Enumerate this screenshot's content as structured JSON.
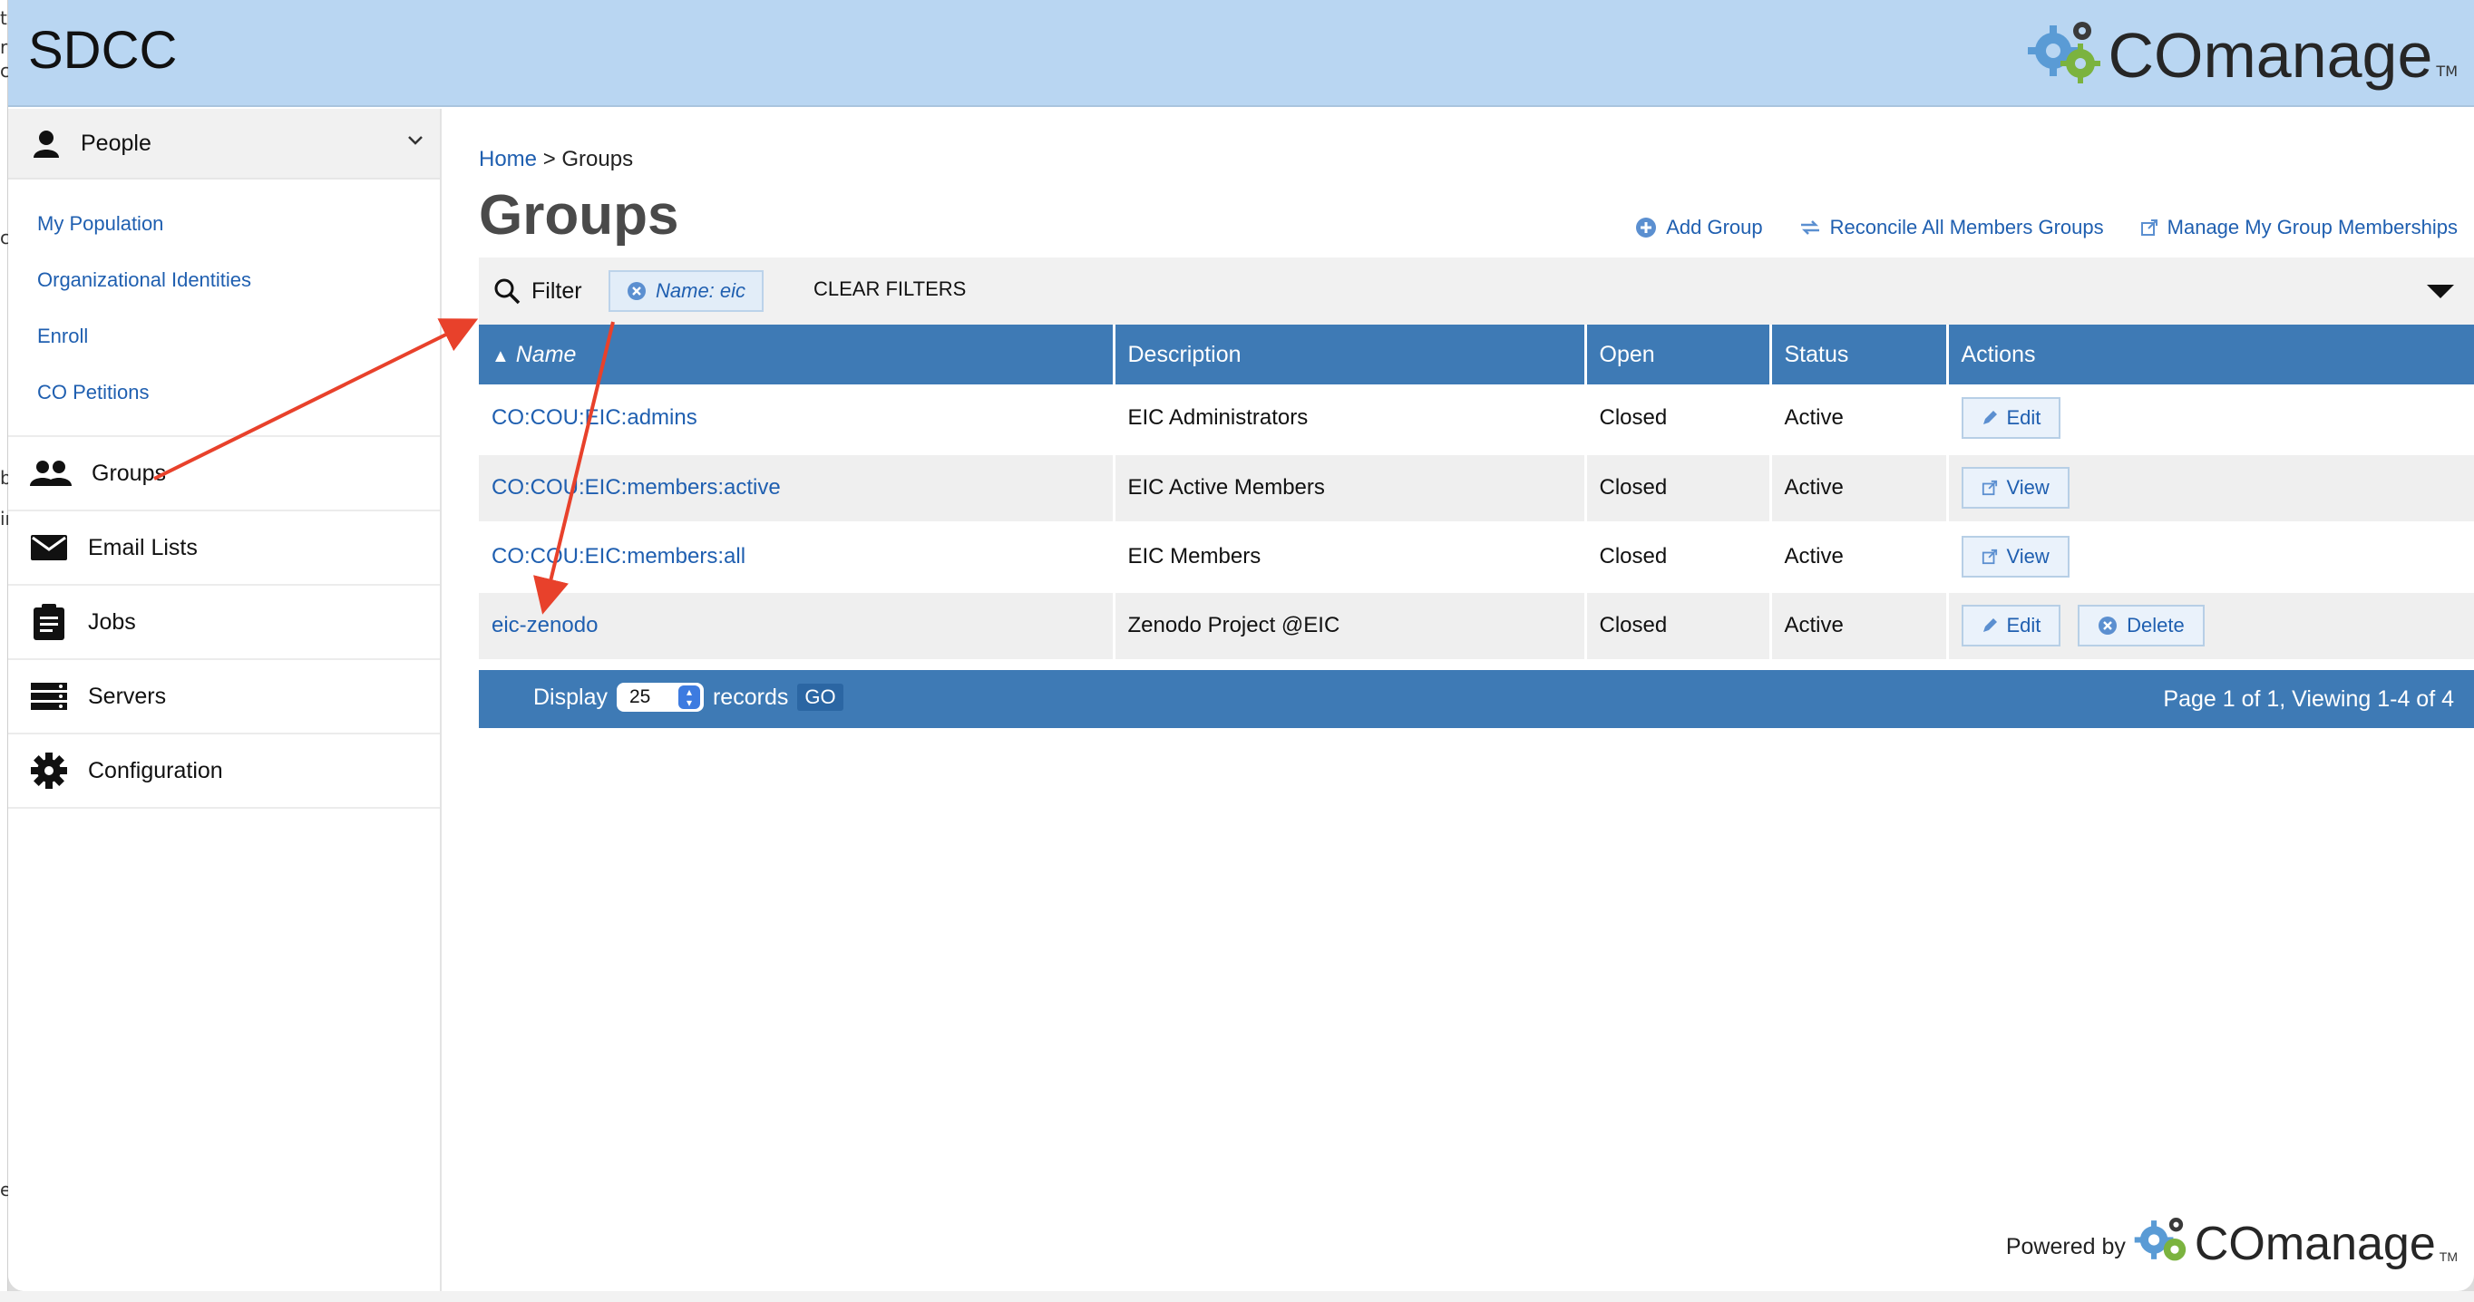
{
  "site": {
    "title": "SDCC"
  },
  "brand": {
    "name": "COmanage",
    "tm": "TM"
  },
  "sidebar": {
    "people_label": "People",
    "people_sub": [
      "My Population",
      "Organizational Identities",
      "Enroll",
      "CO Petitions"
    ],
    "items": [
      {
        "label": "Groups",
        "icon": "people-icon"
      },
      {
        "label": "Email Lists",
        "icon": "envelope-icon"
      },
      {
        "label": "Jobs",
        "icon": "clipboard-icon"
      },
      {
        "label": "Servers",
        "icon": "server-icon"
      },
      {
        "label": "Configuration",
        "icon": "gear-icon"
      }
    ]
  },
  "breadcrumb": {
    "home": "Home",
    "separator": ">",
    "current": "Groups"
  },
  "page": {
    "title": "Groups"
  },
  "actions": {
    "add_group": "Add Group",
    "reconcile": "Reconcile All Members Groups",
    "manage": "Manage My Group Memberships"
  },
  "filter": {
    "label": "Filter",
    "chip": "Name: eic",
    "clear": "CLEAR FILTERS"
  },
  "table": {
    "columns": [
      "Name",
      "Description",
      "Open",
      "Status",
      "Actions"
    ],
    "sort_indicator": "▲",
    "rows": [
      {
        "name": "CO:COU:EIC:admins",
        "description": "EIC Administrators",
        "open": "Closed",
        "status": "Active",
        "actions": [
          "Edit"
        ]
      },
      {
        "name": "CO:COU:EIC:members:active",
        "description": "EIC Active Members",
        "open": "Closed",
        "status": "Active",
        "actions": [
          "View"
        ]
      },
      {
        "name": "CO:COU:EIC:members:all",
        "description": "EIC Members",
        "open": "Closed",
        "status": "Active",
        "actions": [
          "View"
        ]
      },
      {
        "name": "eic-zenodo",
        "description": "Zenodo Project @EIC",
        "open": "Closed",
        "status": "Active",
        "actions": [
          "Edit",
          "Delete"
        ]
      }
    ]
  },
  "pager": {
    "display": "Display",
    "per_page": "25",
    "records": "records",
    "go": "GO",
    "summary": "Page 1 of 1, Viewing 1-4 of 4"
  },
  "footer": {
    "powered_by": "Powered by",
    "brand": "COmanage",
    "tm": "TM"
  },
  "annotation": {
    "arrow_color": "#e8412b"
  }
}
